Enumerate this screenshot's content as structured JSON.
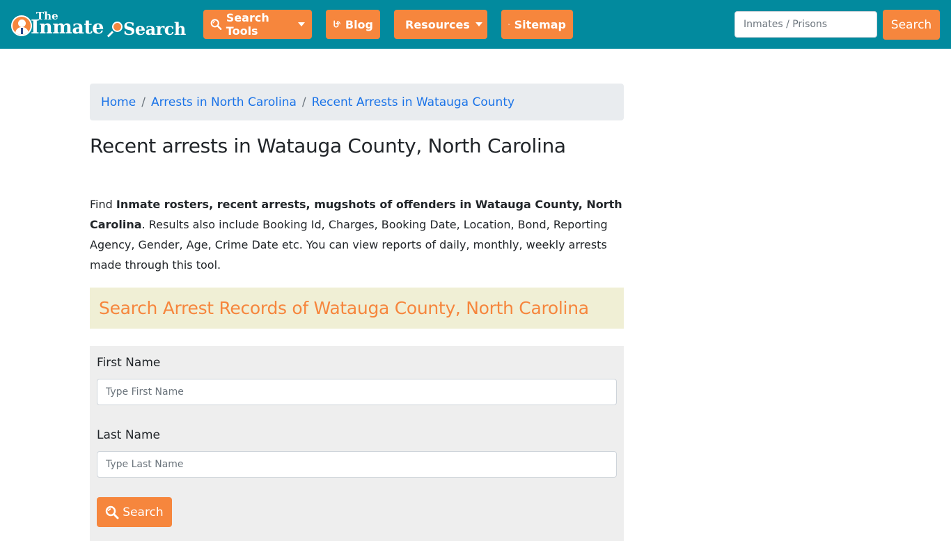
{
  "brand": {
    "logo_the": "The",
    "logo_inmate": "Inmate",
    "logo_search": "Search",
    "primary_color": "#028a9e",
    "accent_color": "#f6863d"
  },
  "nav": {
    "items": [
      {
        "label": "Search Tools",
        "icon": "search-icon",
        "dropdown": true
      },
      {
        "label": "Blog",
        "icon": "blog-icon",
        "dropdown": false
      },
      {
        "label": "Resources",
        "icon": "leaf-icon",
        "dropdown": true
      },
      {
        "label": "Sitemap",
        "icon": "rss-icon",
        "dropdown": false
      }
    ],
    "search_placeholder": "Inmates / Prisons",
    "search_value": "",
    "search_button": "Search"
  },
  "breadcrumb": [
    {
      "label": "Home"
    },
    {
      "label": "Arrests in North Carolina"
    },
    {
      "label": "Recent Arrests in Watauga County"
    }
  ],
  "breadcrumb_separator": "/",
  "page": {
    "title": "Recent arrests in Watauga County, North Carolina",
    "intro_prefix": "Find ",
    "intro_bold": "Inmate rosters, recent arrests, mugshots of offenders in Watauga County, North Carolina",
    "intro_suffix": ". Results also include Booking Id, Charges, Booking Date, Location, Bond, Reporting Agency, Gender, Age, Crime Date etc. You can view reports of daily, monthly, weekly arrests made through this tool."
  },
  "search_form": {
    "heading": "Search Arrest Records of Watauga County, North Carolina",
    "first_name_label": "First Name",
    "first_name_placeholder": "Type First Name",
    "first_name_value": "",
    "last_name_label": "Last Name",
    "last_name_placeholder": "Type Last Name",
    "last_name_value": "",
    "submit_label": "Search"
  }
}
